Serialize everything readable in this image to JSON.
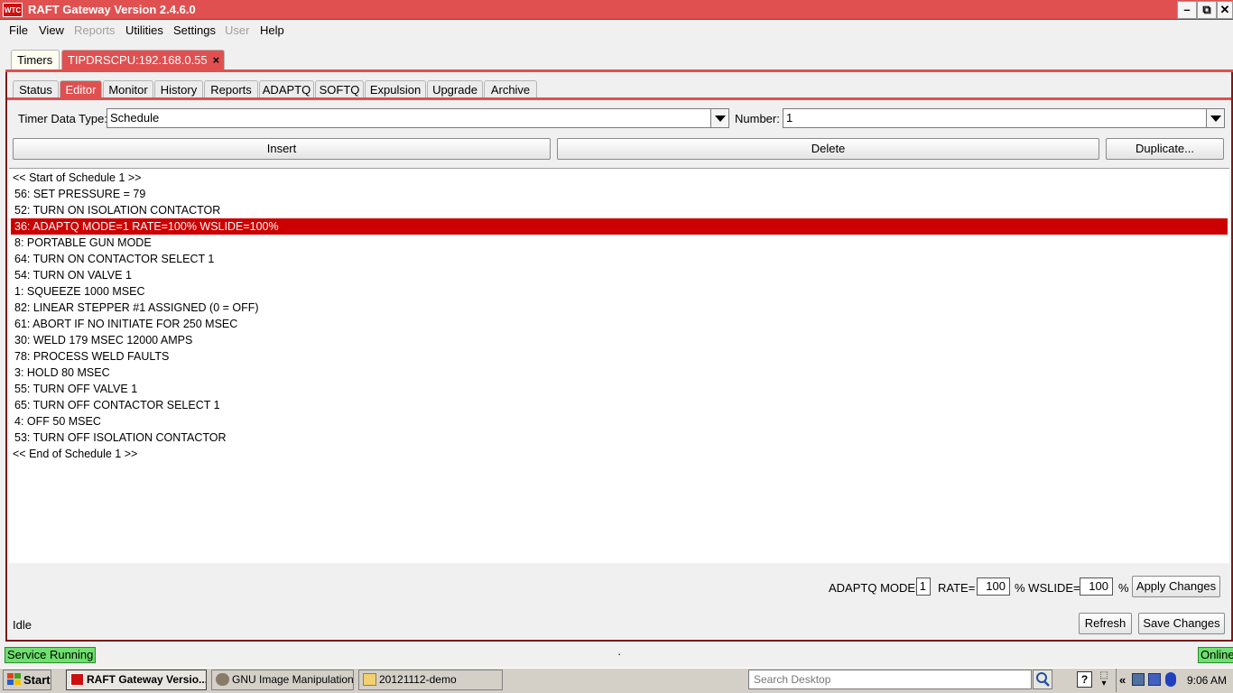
{
  "window": {
    "title": "RAFT Gateway Version 2.4.6.0",
    "logo_text": "WTC",
    "minimize": "–",
    "maximize": "⧉",
    "close": "✕"
  },
  "menu": [
    {
      "label": "File",
      "enabled": true
    },
    {
      "label": "View",
      "enabled": true
    },
    {
      "label": "Reports",
      "enabled": false
    },
    {
      "label": "Utilities",
      "enabled": true
    },
    {
      "label": "Settings",
      "enabled": true
    },
    {
      "label": "User",
      "enabled": false
    },
    {
      "label": "Help",
      "enabled": true
    }
  ],
  "outer_tabs": {
    "timers": "Timers",
    "connection": "TIPDRSCPU:192.168.0.55",
    "close_glyph": "×"
  },
  "inner_tabs": [
    "Status",
    "Editor",
    "Monitor",
    "History",
    "Reports",
    "ADAPTQ",
    "SOFTQ",
    "Expulsion",
    "Upgrade",
    "Archive"
  ],
  "active_inner_tab": "Editor",
  "editor": {
    "data_type_label": "Timer Data Type:",
    "data_type_value": "Schedule",
    "number_label": "Number:",
    "number_value": "1",
    "insert_label": "Insert",
    "delete_label": "Delete",
    "duplicate_label": "Duplicate...",
    "rows": [
      "<< Start of Schedule 1 >>",
      "56: SET PRESSURE = 79",
      "52: TURN ON ISOLATION CONTACTOR",
      "36: ADAPTQ MODE=1 RATE=100% WSLIDE=100%",
      "8: PORTABLE GUN MODE",
      "64: TURN ON CONTACTOR SELECT 1",
      "54: TURN ON VALVE 1",
      "1: SQUEEZE 1000 MSEC",
      "82: LINEAR STEPPER #1 ASSIGNED (0 = OFF)",
      "61: ABORT IF NO INITIATE FOR 250 MSEC",
      "30: WELD 179 MSEC 12000 AMPS",
      "78: PROCESS WELD FAULTS",
      "3: HOLD 80 MSEC",
      "55: TURN OFF VALVE 1",
      "65: TURN OFF CONTACTOR SELECT 1",
      "4: OFF 50 MSEC",
      "53: TURN OFF ISOLATION CONTACTOR",
      "<< End of Schedule 1 >>"
    ],
    "selected_row": 3,
    "adaptq_mode_label": "ADAPTQ MODE=",
    "adaptq_mode_value": "1",
    "rate_label": "RATE=",
    "rate_value": "100",
    "wslide_label": "% WSLIDE=",
    "wslide_value": "100",
    "percent_label": "%",
    "apply_label": "Apply Changes",
    "status_text": "Idle",
    "refresh_label": "Refresh",
    "save_label": "Save Changes"
  },
  "statusbar": {
    "service": "Service Running",
    "center_dot": "·",
    "online": "Online"
  },
  "taskbar": {
    "start": "Start",
    "items": [
      "RAFT Gateway Versio...",
      "GNU Image Manipulation ...",
      "20121112-demo"
    ],
    "search_placeholder": "Search Desktop",
    "clock": "9:06 AM",
    "chevron": "«"
  },
  "colors": {
    "accent": "#e05050",
    "selected_row": "#cc0000",
    "online_green": "#6ee06e"
  }
}
